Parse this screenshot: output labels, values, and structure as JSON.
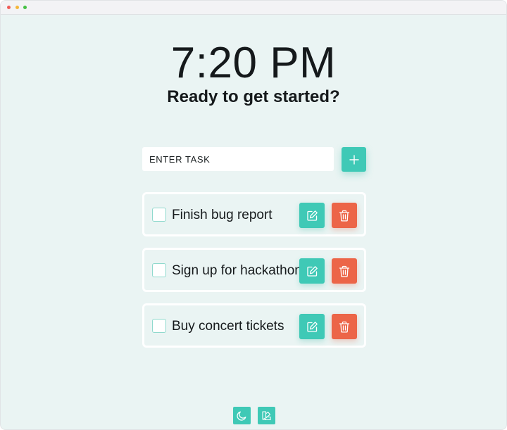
{
  "colors": {
    "accent": "#3fc9b6",
    "danger": "#ec6548",
    "background": "#eaf4f3",
    "text": "#15191b",
    "traffic_red": "#f05c57",
    "traffic_yellow": "#f5b638",
    "traffic_green": "#44c043"
  },
  "header": {
    "time": "7:20 PM",
    "subtitle": "Ready to get started?"
  },
  "new_task": {
    "placeholder": "ENTER TASK",
    "value": "",
    "add_icon": "plus-icon"
  },
  "tasks": [
    {
      "label": "Finish bug report",
      "done": false,
      "edit_icon": "edit-icon",
      "delete_icon": "trash-icon"
    },
    {
      "label": "Sign up for hackathon",
      "done": false,
      "edit_icon": "edit-icon",
      "delete_icon": "trash-icon"
    },
    {
      "label": "Buy concert tickets",
      "done": false,
      "edit_icon": "edit-icon",
      "delete_icon": "trash-icon"
    }
  ],
  "footer": {
    "theme_icon": "moon-icon",
    "palette_icon": "palette-icon"
  }
}
